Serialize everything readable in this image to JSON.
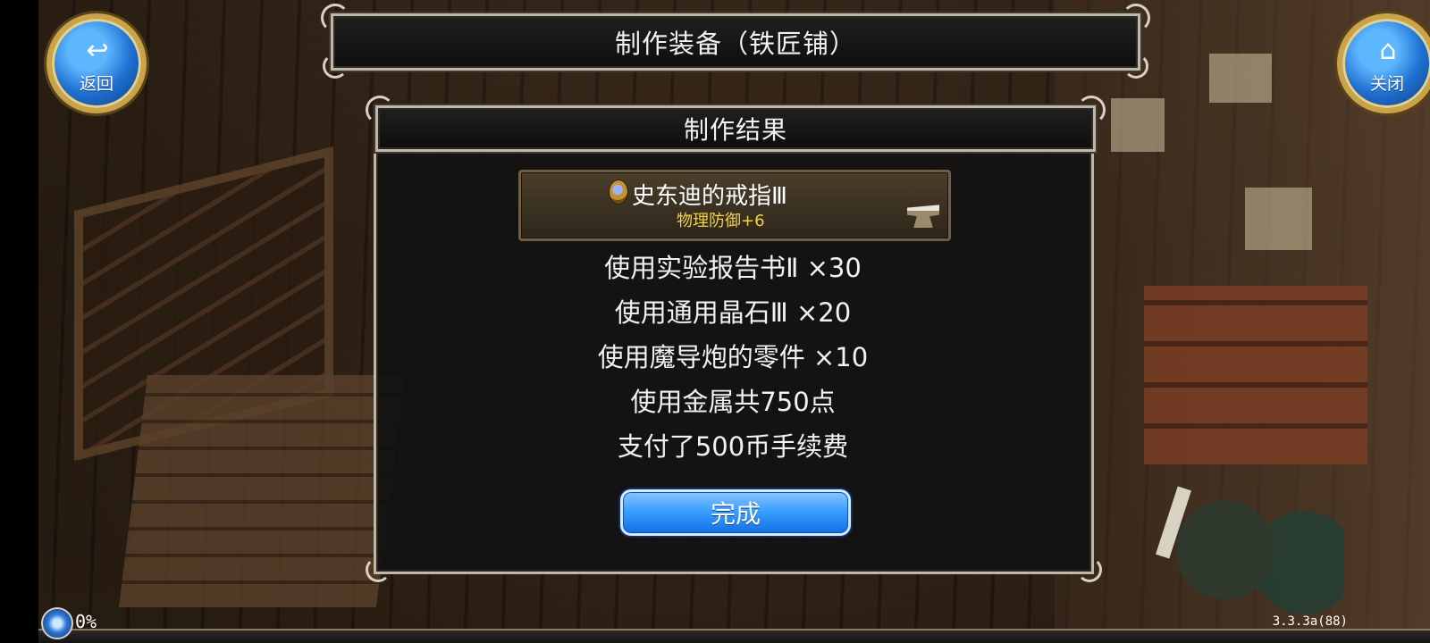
{
  "buttons": {
    "back": {
      "icon": "return-arrow-icon",
      "label": "返回"
    },
    "close": {
      "icon": "home-icon",
      "label": "关闭"
    }
  },
  "title_bar": {
    "title": "制作装备（铁匠铺）"
  },
  "result_panel": {
    "header": "制作结果",
    "item": {
      "name": "史东迪的戒指Ⅲ",
      "stat": "物理防御+6",
      "icon": "ring-icon",
      "type_icon": "anvil-icon"
    },
    "lines": [
      "使用实验报告书Ⅱ ×30",
      "使用通用晶石Ⅲ ×20",
      "使用魔导炮的零件 ×10",
      "使用金属共750点",
      "支付了500币手续费"
    ],
    "done_button": "完成"
  },
  "status": {
    "progress": "0%",
    "version": "3.3.3a(88)"
  }
}
